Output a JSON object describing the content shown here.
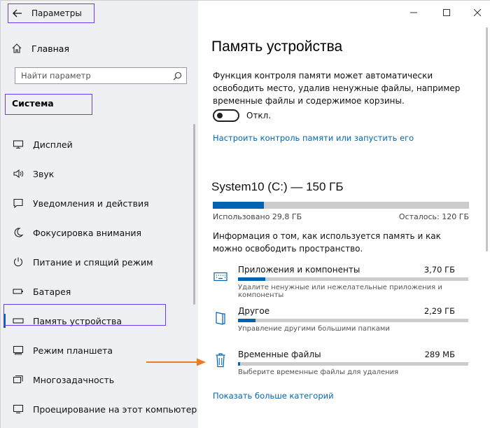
{
  "app": {
    "title": "Параметры"
  },
  "nav": {
    "home": "Главная",
    "search_placeholder": "Найти параметр",
    "section": "Система",
    "items": [
      {
        "label": "Дисплей",
        "icon": "monitor-icon"
      },
      {
        "label": "Звук",
        "icon": "speaker-icon"
      },
      {
        "label": "Уведомления и действия",
        "icon": "notification-icon"
      },
      {
        "label": "Фокусировка внимания",
        "icon": "moon-icon"
      },
      {
        "label": "Питание и спящий режим",
        "icon": "power-icon"
      },
      {
        "label": "Батарея",
        "icon": "battery-icon"
      },
      {
        "label": "Память устройства",
        "icon": "storage-icon",
        "active": true
      },
      {
        "label": "Режим планшета",
        "icon": "tablet-icon"
      },
      {
        "label": "Многозадачность",
        "icon": "multitask-icon"
      },
      {
        "label": "Проецирование на этот компьютер",
        "icon": "project-icon"
      }
    ]
  },
  "content": {
    "title": "Память устройства",
    "description": "Функция контроля памяти может автоматически освободить место, удалив ненужные файлы, например временные файлы и содержимое корзины.",
    "toggle_label": "Откл.",
    "toggle_on": false,
    "config_link": "Настроить контроль памяти или запустить его",
    "drive": {
      "title": "System10 (C:) — 150 ГБ",
      "used": "Использовано 29,8 ГБ",
      "free": "Осталось: 120 ГБ",
      "used_fraction": 0.199
    },
    "info": "Информация о том, как используется память и как можно освободить пространство.",
    "categories": [
      {
        "name": "Приложения и компоненты",
        "size": "3,70 ГБ",
        "hint": "Удалите ненужные или нежелательные приложения и компоненты",
        "fill": 0.12,
        "icon": "keyboard-icon"
      },
      {
        "name": "Другое",
        "size": "2,29 ГБ",
        "hint": "Управление другими большими папками",
        "fill": 0.075,
        "icon": "folder-icon"
      },
      {
        "name": "Временные файлы",
        "size": "289 МБ",
        "hint": "Выберите временные файлы для удаления",
        "fill": 0.01,
        "icon": "trash-icon"
      }
    ],
    "more_link": "Показать больше категорий"
  },
  "colors": {
    "accent": "#0063b1",
    "link": "#0066b4",
    "highlight": "#6a3df0",
    "arrow": "#f07a1e"
  }
}
